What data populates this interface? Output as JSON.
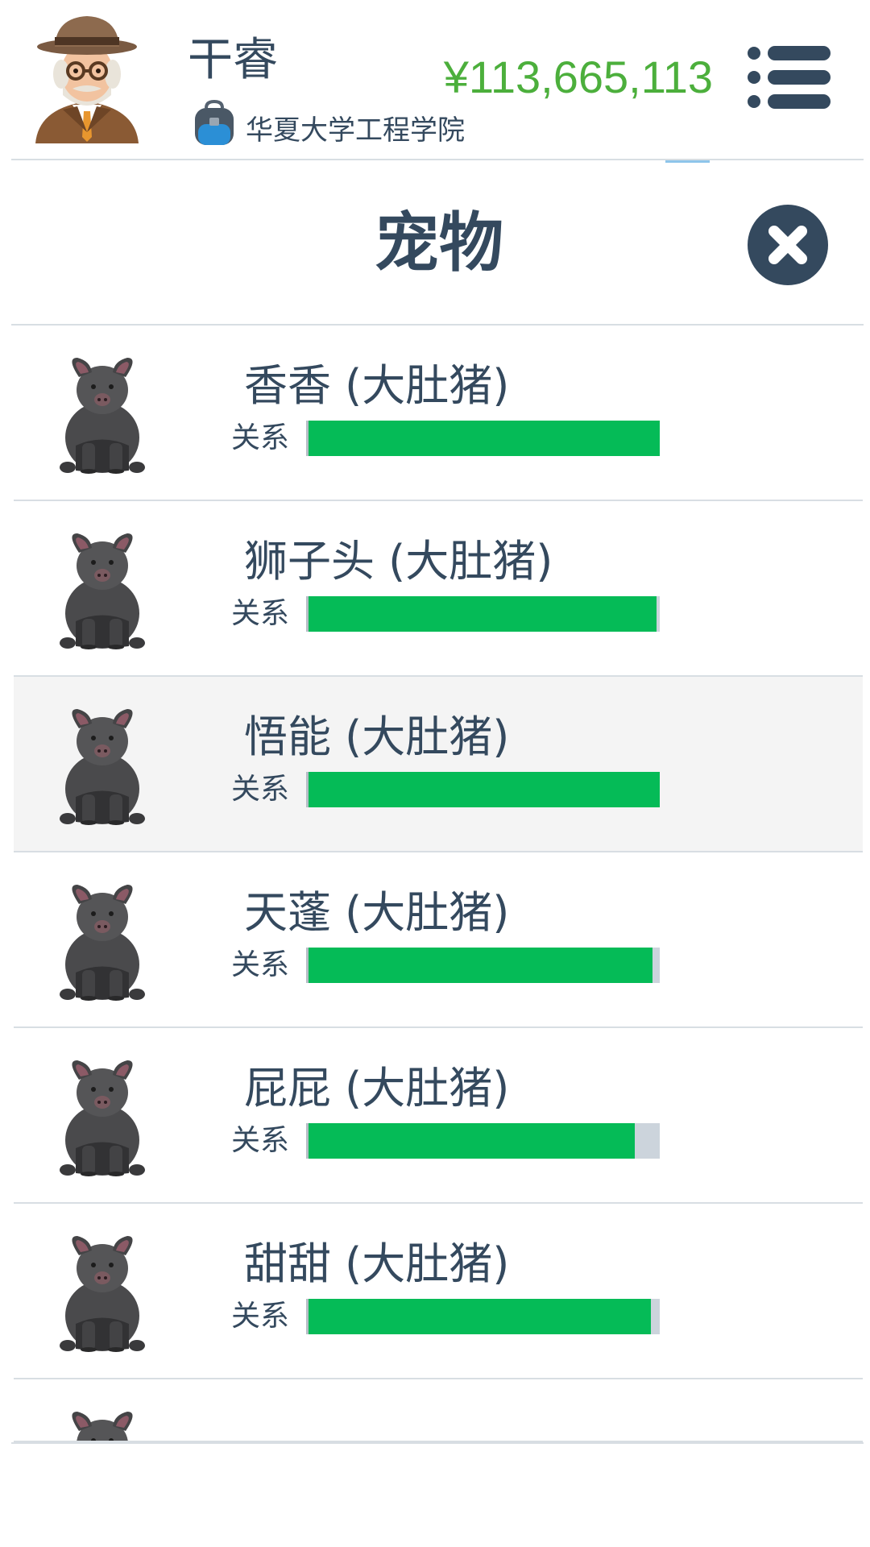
{
  "header": {
    "player_name": "干睿",
    "school": "华夏大学工程学院",
    "money": "¥113,665,113"
  },
  "panel": {
    "title": "宠物"
  },
  "pets": [
    {
      "name": "香香 (大肚猪)",
      "relation_label": "关系",
      "relation": 1.0,
      "highlighted": false
    },
    {
      "name": "狮子头 (大肚猪)",
      "relation_label": "关系",
      "relation": 0.99,
      "highlighted": false
    },
    {
      "name": "悟能 (大肚猪)",
      "relation_label": "关系",
      "relation": 1.0,
      "highlighted": true
    },
    {
      "name": "天蓬 (大肚猪)",
      "relation_label": "关系",
      "relation": 0.98,
      "highlighted": false
    },
    {
      "name": "屁屁 (大肚猪)",
      "relation_label": "关系",
      "relation": 0.93,
      "highlighted": false
    },
    {
      "name": "甜甜 (大肚猪)",
      "relation_label": "关系",
      "relation": 0.975,
      "highlighted": false
    }
  ],
  "colors": {
    "text": "#34495e",
    "money": "#4caf3c",
    "relation_fill": "#05bb57",
    "relation_track": "#ccd4dc",
    "highlight_row": "#f4f4f4"
  },
  "icons": {
    "avatar": "old-professor-avatar",
    "school": "backpack-icon",
    "menu": "list-menu-icon",
    "close": "close-icon",
    "pet": "pot-bellied-pig-icon"
  }
}
